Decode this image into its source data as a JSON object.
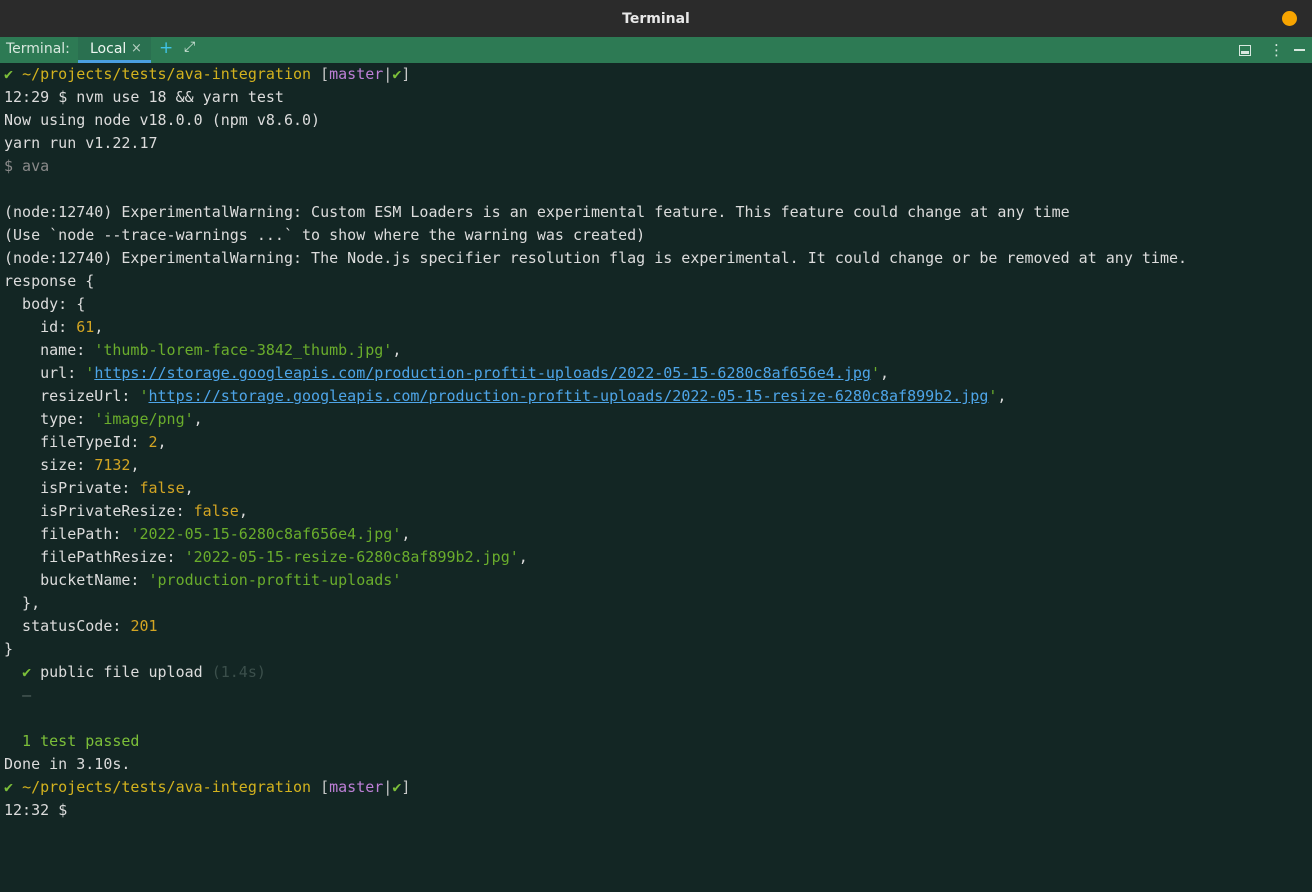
{
  "window": {
    "title": "Terminal"
  },
  "toolbar": {
    "label": "Terminal:",
    "tab_label": "Local",
    "tab_close": "×",
    "new_tab": "+",
    "expand": "⤢",
    "more": "⋮"
  },
  "terminal": {
    "check": "✔",
    "path": "~/projects/tests/ava-integration",
    "bracket_open": "[",
    "branch": "master",
    "sep": "|",
    "bracket_close": "]",
    "prompt1_time": "12:29",
    "prompt1_cmd": "$ nvm use 18 && yarn test",
    "out_node": "Now using node v18.0.0 (npm v8.6.0)",
    "out_yarn": "yarn run v1.22.17",
    "out_ava": "$ ava",
    "warn1": "(node:12740) ExperimentalWarning: Custom ESM Loaders is an experimental feature. This feature could change at any time",
    "warn2": "(Use `node --trace-warnings ...` to show where the warning was created)",
    "warn3": "(node:12740) ExperimentalWarning: The Node.js specifier resolution flag is experimental. It could change or be removed at any time.",
    "resp_open": "response {",
    "body_open": "  body: {",
    "k_id": "    id: ",
    "v_id": "61",
    "k_name": "    name: ",
    "v_name": "'thumb-lorem-face-3842_thumb.jpg'",
    "k_url": "    url: ",
    "v_url": "https://storage.googleapis.com/production-proftit-uploads/2022-05-15-6280c8af656e4.jpg",
    "k_resize": "    resizeUrl: ",
    "v_resize": "https://storage.googleapis.com/production-proftit-uploads/2022-05-15-resize-6280c8af899b2.jpg",
    "k_type": "    type: ",
    "v_type": "'image/png'",
    "k_ftid": "    fileTypeId: ",
    "v_ftid": "2",
    "k_size": "    size: ",
    "v_size": "7132",
    "k_priv": "    isPrivate: ",
    "v_priv": "false",
    "k_privr": "    isPrivateResize: ",
    "v_privr": "false",
    "k_fp": "    filePath: ",
    "v_fp": "'2022-05-15-6280c8af656e4.jpg'",
    "k_fpr": "    filePathResize: ",
    "v_fpr": "'2022-05-15-resize-6280c8af899b2.jpg'",
    "k_bucket": "    bucketName: ",
    "v_bucket": "'production-proftit-uploads'",
    "body_close": "  },",
    "k_status": "  statusCode: ",
    "v_status": "201",
    "resp_close": "}",
    "test_name": "public file upload",
    "test_time": "(1.4s)",
    "test_dash": "—",
    "summary": "  1 test passed",
    "done": "Done in 3.10s.",
    "prompt2_time": "12:32",
    "prompt2_cmd": "$"
  }
}
